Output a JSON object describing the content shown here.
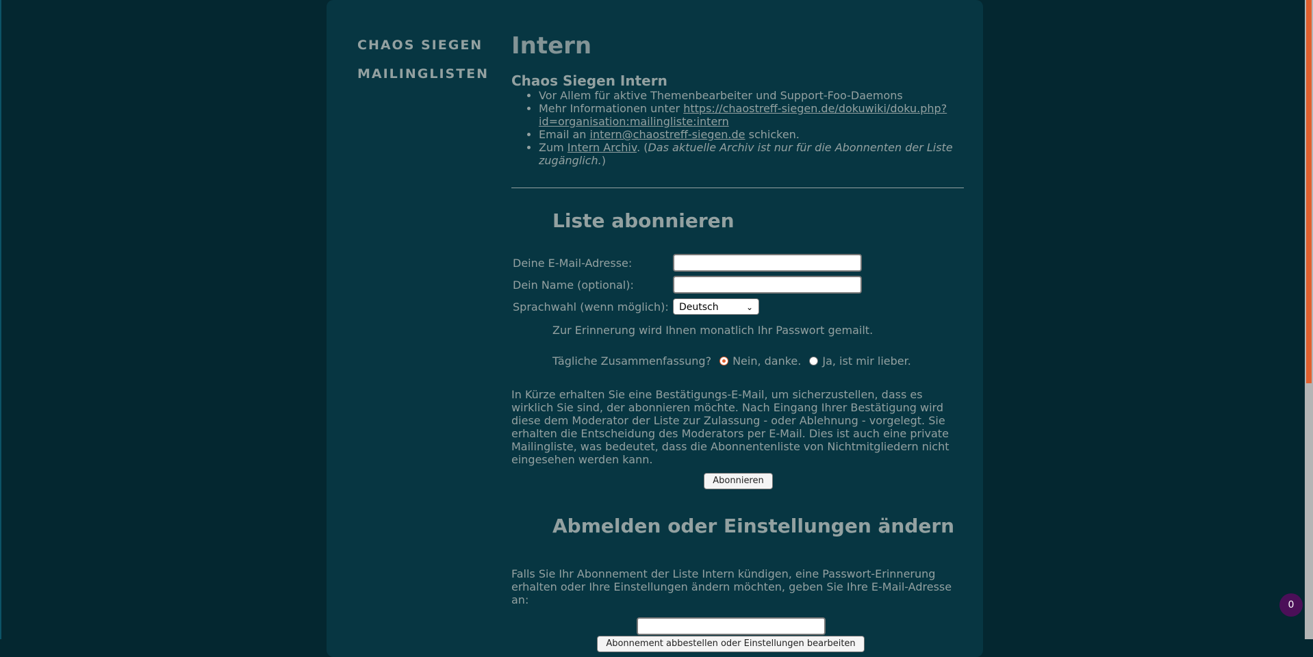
{
  "sidebar": {
    "items": [
      {
        "label": "CHAOS SIEGEN"
      },
      {
        "label": "MAILINGLISTEN"
      }
    ]
  },
  "page": {
    "title": "Intern",
    "list_title": "Chaos Siegen Intern",
    "info": {
      "line1": "Vor Allem für aktive Themenbearbeiter und Support-Foo-Daemons",
      "line2_prefix": "Mehr Informationen unter",
      "line2_link": "https://chaostreff-siegen.de/dokuwiki/doku.php?id=organisation:mailingliste:intern",
      "line3_prefix": "Email an",
      "line3_link": "intern@chaostreff-siegen.de",
      "line3_suffix": "schicken.",
      "line4_prefix": "Zum",
      "line4_link": "Intern Archiv",
      "line4_mid": ". (",
      "line4_em": "Das aktuelle Archiv ist nur für die Abonnenten der Liste zugänglich.",
      "line4_end": ")"
    }
  },
  "subscribe": {
    "heading": "Liste abonnieren",
    "email_label": "Deine E-Mail-Adresse:",
    "email_value": "",
    "name_label": "Dein Name (optional):",
    "name_value": "",
    "lang_label": "Sprachwahl (wenn möglich):",
    "lang_selected": "Deutsch",
    "reminder": "Zur Erinnerung wird Ihnen monatlich Ihr Passwort gemailt.",
    "digest_label": "Tägliche Zusammenfassung?",
    "digest_no": "Nein, danke.",
    "digest_yes": "Ja, ist mir lieber.",
    "digest_selected": "no",
    "explanation": "In Kürze erhalten Sie eine Bestätigungs-E-Mail, um sicherzustellen, dass es wirklich Sie sind, der abonnieren möchte. Nach Eingang Ihrer Bestätigung wird diese dem Moderator der Liste zur Zulassung - oder Ablehnung - vorgelegt. Sie erhalten die Entscheidung des Moderators per E-Mail. Dies ist auch eine private Mailingliste, was bedeutet, dass die Abonnentenliste von Nichtmitgliedern nicht eingesehen werden kann.",
    "button": "Abonnieren"
  },
  "unsubscribe": {
    "heading": "Abmelden oder Einstellungen ändern",
    "text": "Falls Sie Ihr Abonnement der Liste Intern kündigen, eine Passwort-Erinnerung erhalten oder Ihre Einstellungen ändern möchten, geben Sie Ihre E-Mail-Adresse an:",
    "email_value": "",
    "button": "Abonnement abbestellen oder Einstellungen bearbeiten"
  },
  "badge": {
    "count": "0"
  },
  "colors": {
    "background": "#042730",
    "panel": "#073642",
    "text": "#93a1a1",
    "accent": "#e0602e",
    "badge": "#4b0f58"
  }
}
